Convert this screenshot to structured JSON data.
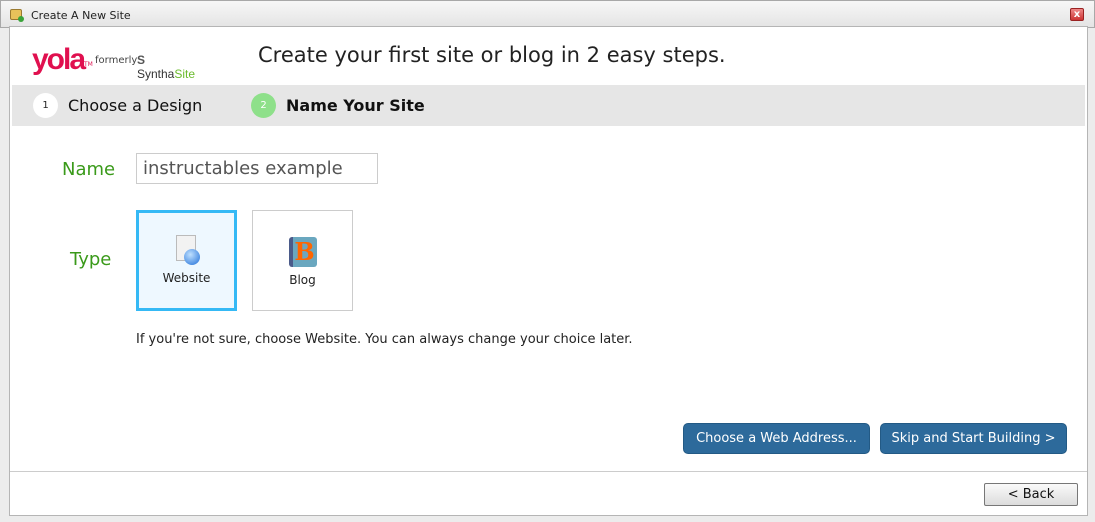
{
  "window": {
    "title": "Create A New Site",
    "close_label": "x"
  },
  "logo": {
    "brand": "yola",
    "tm": "TM",
    "formerly": "formerly",
    "synth_a": "Syntha",
    "synth_b": "Site"
  },
  "headline": "Create your first site or blog in 2 easy steps.",
  "steps": [
    {
      "number": "1",
      "label": "Choose a Design",
      "active": false
    },
    {
      "number": "2",
      "label": "Name Your Site",
      "active": true
    }
  ],
  "form": {
    "name_label": "Name",
    "name_value": "instructables example",
    "type_label": "Type",
    "types": [
      {
        "label": "Website",
        "icon": "website-globe-icon",
        "selected": true
      },
      {
        "label": "Blog",
        "icon": "blog-book-icon",
        "selected": false
      }
    ],
    "hint": "If you're not sure, choose Website. You can always change your choice later."
  },
  "buttons": {
    "choose_address": "Choose a Web Address...",
    "skip": "Skip and Start Building >",
    "back": "< Back"
  },
  "colors": {
    "accent_green": "#3a9a1a",
    "button_blue": "#2d6a9b",
    "selected_border": "#35b9f5",
    "brand_pink": "#e0104f"
  }
}
